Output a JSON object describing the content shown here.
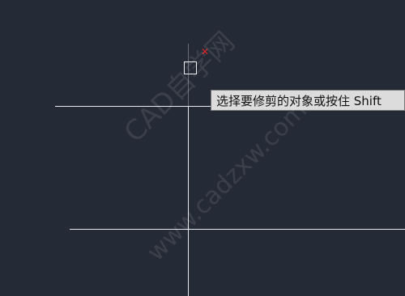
{
  "prompt": {
    "tooltip_text": "选择要修剪的对象或按住 Shift"
  },
  "watermark": {
    "line1": "CAD自学网",
    "line2": "www.cadzxw.com"
  },
  "colors": {
    "background": "#242a36",
    "lines": "#e7e9ef",
    "marker": "#e2232b",
    "tooltip_bg": "#dcdcdc"
  },
  "icons": {
    "marker": "x-mark-icon",
    "cursor": "pickbox-cursor"
  }
}
